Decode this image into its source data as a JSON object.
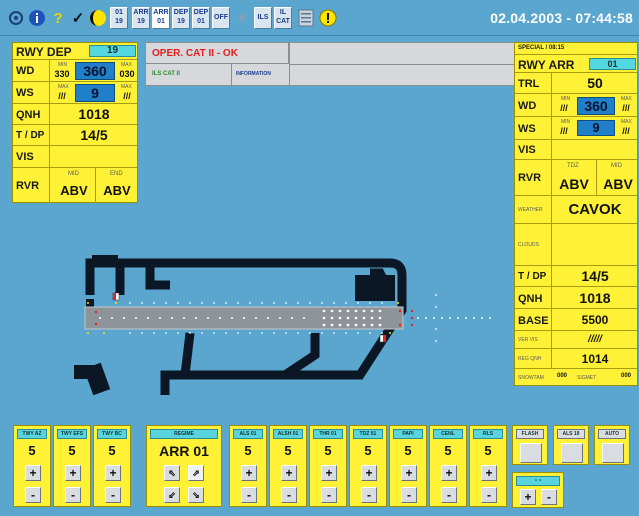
{
  "toolbar": {
    "icons": [
      "settings-icon",
      "info-icon",
      "help-icon",
      "check-icon",
      "night-mode-icon"
    ],
    "buttons": [
      {
        "name": "rwy-01-19-toggle",
        "label": "01\n19"
      },
      {
        "name": "arr-19-button",
        "label": "ARR\n19"
      },
      {
        "name": "arr-01-button",
        "label": "ARR\n01"
      },
      {
        "name": "dep-19-button",
        "label": "DEP\n19"
      },
      {
        "name": "dep-01-button",
        "label": "DEP\n01"
      },
      {
        "name": "off-button",
        "label": "OFF"
      },
      {
        "name": "ils-button",
        "label": "ILS"
      },
      {
        "name": "ils-cat-button",
        "label": "IL\nCAT"
      }
    ],
    "datetime": "02.04.2003 - 07:44:58"
  },
  "rwy_dep": {
    "title": "RWY DEP",
    "runway": "19",
    "wd_label": "WD",
    "wd_min_label": "MIN",
    "wd_max_label": "MAX",
    "wd_min": "330",
    "wd_value": "360",
    "wd_max": "030",
    "ws_label": "WS",
    "ws_min_label": "MAX",
    "ws_max_label": "MAX",
    "ws_min": "///",
    "ws_value": "9",
    "ws_max": "///",
    "qnh_label": "QNH",
    "qnh": "1018",
    "tdp_label": "T / DP",
    "tdp": "14/5",
    "vis_label": "VIS",
    "rvr_label": "RVR",
    "rvr_mid_label": "MID",
    "rvr_end_label": "END",
    "rvr_mid": "ABV",
    "rvr_end": "ABV"
  },
  "info": {
    "status": "OPER. CAT II - OK",
    "ils_cat": "ILS CAT II",
    "information_label": "INFORMATION"
  },
  "rwy_arr": {
    "special": "SPECIAL / 08:15",
    "title": "RWY ARR",
    "runway": "01",
    "trl_label": "TRL",
    "trl": "50",
    "wd_label": "WD",
    "wd_min_label": "MIN",
    "wd_max_label": "MAX",
    "wd_min": "///",
    "wd_value": "360",
    "wd_max": "///",
    "ws_label": "WS",
    "ws_min_label": "MIN",
    "ws_max_label": "MAX",
    "ws_min": "///",
    "ws_value": "9",
    "ws_max": "///",
    "vis_label": "VIS",
    "rvr_label": "RVR",
    "rvr_tdz_label": "TDZ",
    "rvr_mid_label": "MID",
    "rvr_tdz": "ABV",
    "rvr_mid": "ABV",
    "weather_label": "WEATHER",
    "weather": "CAVOK",
    "clouds_label": "CLOUDS",
    "tdp_label": "T / DP",
    "tdp": "14/5",
    "qnh_label": "QNH",
    "qnh": "1018",
    "base_label": "BASE",
    "base": "5500",
    "vervis_label": "VER VIS",
    "vervis": "/////",
    "regqnh_label": "REG QNH",
    "regqnh": "1014",
    "snowtam_label": "SNOWTAM",
    "snowtam": "000",
    "sigmet_label": "SIGMET",
    "sigmet": "000"
  },
  "controls": {
    "twy_az": {
      "label": "TWY AZ",
      "value": "5"
    },
    "twy_efs": {
      "label": "TWY EFS",
      "value": "5"
    },
    "twy_bc": {
      "label": "TWY BC",
      "value": "5"
    },
    "regime": {
      "label": "REGIME",
      "value": "ARR 01"
    },
    "als01": {
      "label": "ALS 01",
      "value": "5"
    },
    "alsh01": {
      "label": "ALSH 01",
      "value": "5"
    },
    "thr01": {
      "label": "THR 01",
      "value": "5"
    },
    "tdz01": {
      "label": "TDZ 01",
      "value": "5"
    },
    "papi": {
      "label": "PAPI",
      "value": "5"
    },
    "cenl": {
      "label": "CENL",
      "value": "5"
    },
    "rls": {
      "label": "RLS",
      "value": "5"
    },
    "flash": {
      "label": "FLASH"
    },
    "als19": {
      "label": "ALS 19"
    },
    "auto": {
      "label": "AUTO"
    },
    "master": {
      "label": "- -"
    },
    "plus": "+",
    "minus": "-"
  }
}
